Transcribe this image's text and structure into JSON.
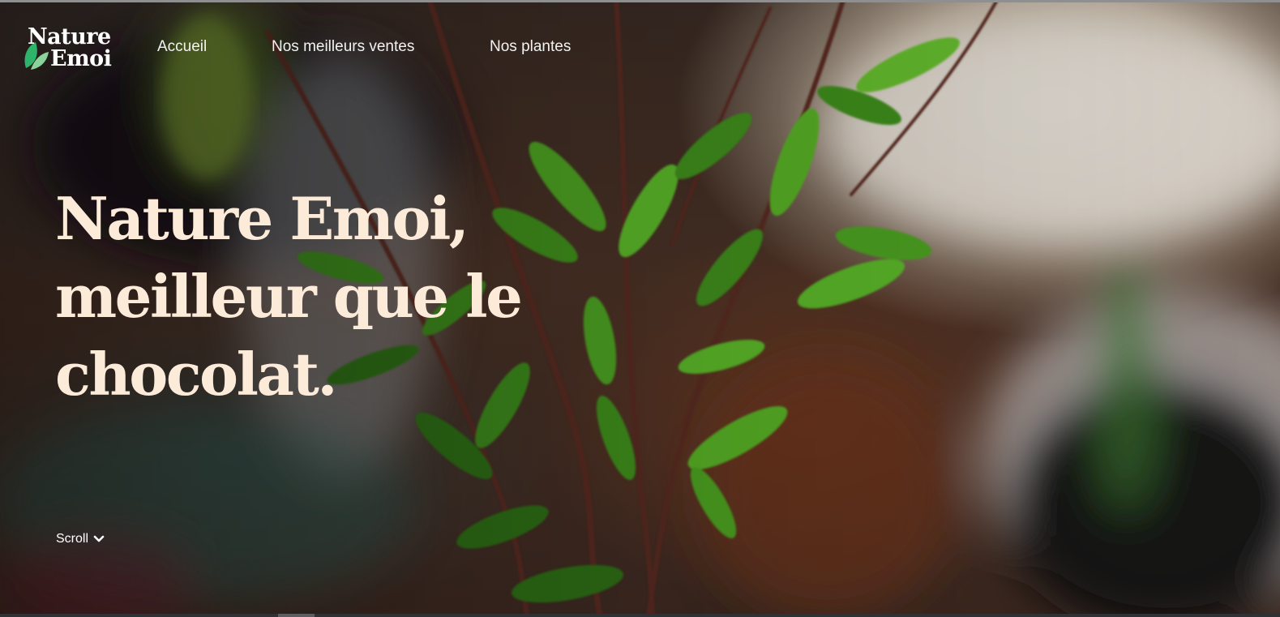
{
  "brand": {
    "line1": "Nature",
    "line2": "Emoi",
    "accent_color": "#2db36a"
  },
  "nav": {
    "items": [
      {
        "label": "Accueil"
      },
      {
        "label": "Nos meilleurs ventes"
      },
      {
        "label": "Nos plantes"
      }
    ]
  },
  "hero": {
    "headline_lines": [
      "Nature Emoi,",
      "meilleur que le",
      "chocolat."
    ],
    "headline_color": "#fdebd9",
    "scroll_label": "Scroll",
    "scroll_icon": "chevron-down-icon"
  }
}
